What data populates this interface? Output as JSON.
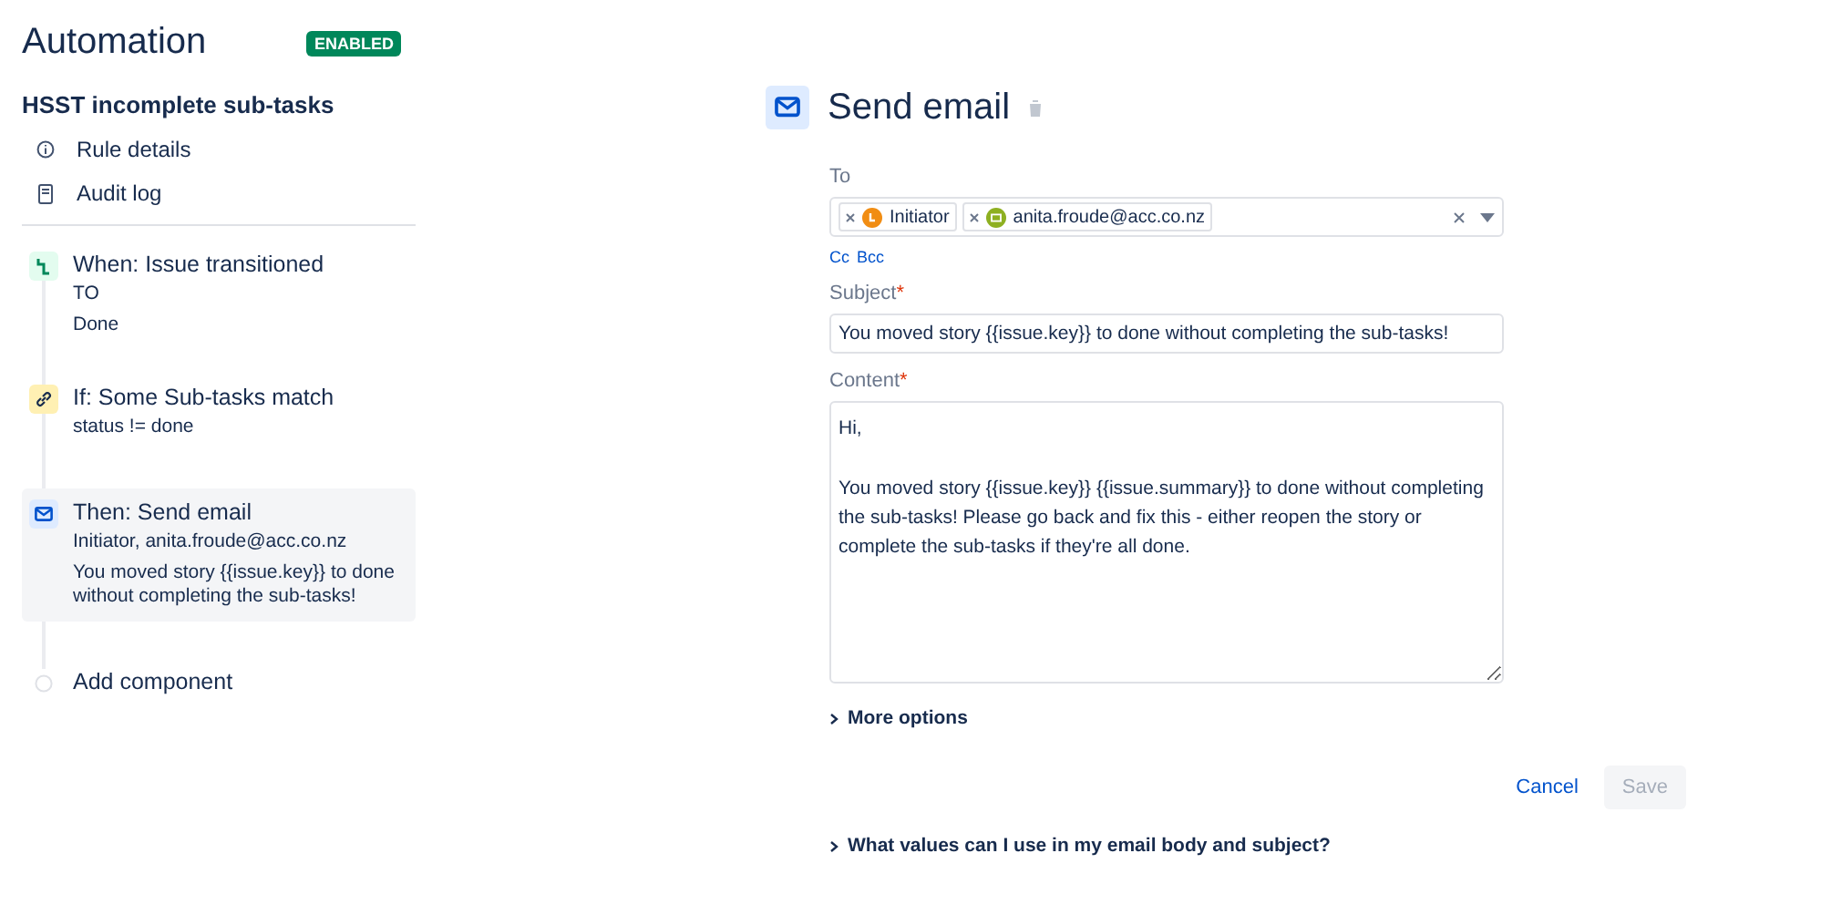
{
  "sidebar": {
    "title": "Automation",
    "status_badge": "ENABLED",
    "rule_name": "HSST incomplete sub-tasks",
    "links": [
      {
        "kind": "info",
        "label": "Rule details"
      },
      {
        "kind": "log",
        "label": "Audit log"
      }
    ],
    "components": [
      {
        "kind": "trigger",
        "title": "When: Issue transitioned",
        "lines": [
          "TO",
          "Done"
        ],
        "selected": false
      },
      {
        "kind": "condition",
        "title": "If: Some Sub-tasks match",
        "lines": [
          "status != done"
        ],
        "selected": false
      },
      {
        "kind": "action",
        "title": "Then: Send email",
        "lines": [
          "Initiator, anita.froude@acc.co.nz",
          "You moved story {{issue.key}} to done without completing the sub-tasks!"
        ],
        "selected": true
      },
      {
        "kind": "add",
        "title": "Add component",
        "selected": false
      }
    ]
  },
  "editor": {
    "title": "Send email",
    "to_label": "To",
    "recipients": [
      {
        "kind": "user",
        "label": "Initiator",
        "color": "#f18d13"
      },
      {
        "kind": "email",
        "label": "anita.froude@acc.co.nz",
        "color": "#8eb021"
      }
    ],
    "cc_link": "Cc",
    "bcc_link": "Bcc",
    "subject_label": "Subject",
    "subject_required": "*",
    "subject_value": "You moved story {{issue.key}} to done without completing the sub-tasks!",
    "content_label": "Content",
    "content_required": "*",
    "content_value": "Hi,\n\nYou moved story {{issue.key}} {{issue.summary}} to done without completing the sub-tasks! Please go back and fix this - either reopen the story or complete the sub-tasks if they're all done.",
    "more_options": "More options",
    "cancel": "Cancel",
    "save": {
      "label": "Save",
      "disabled": true
    },
    "help": "What values can I use in my email body and subject?"
  }
}
